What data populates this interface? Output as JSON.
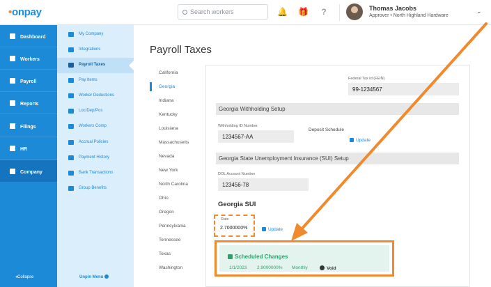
{
  "app": {
    "logo": "onpay"
  },
  "header": {
    "search_placeholder": "Search workers",
    "user_name": "Thomas Jacobs",
    "user_role": "Approver • North Highland Hardware"
  },
  "sidebar": {
    "items": [
      {
        "label": "Dashboard",
        "icon": "dashboard-icon"
      },
      {
        "label": "Workers",
        "icon": "workers-icon"
      },
      {
        "label": "Payroll",
        "icon": "payroll-icon"
      },
      {
        "label": "Reports",
        "icon": "reports-icon"
      },
      {
        "label": "Filings",
        "icon": "filings-icon"
      },
      {
        "label": "HR",
        "icon": "hr-icon"
      },
      {
        "label": "Company",
        "icon": "company-icon",
        "active": true
      }
    ],
    "collapse_label": "Collapse"
  },
  "subnav": {
    "items": [
      {
        "label": "My Company"
      },
      {
        "label": "Integrations"
      },
      {
        "label": "Payroll Taxes",
        "active": true
      },
      {
        "label": "Pay Items"
      },
      {
        "label": "Worker Deductions"
      },
      {
        "label": "Loc/Dep/Pos"
      },
      {
        "label": "Workers Comp"
      },
      {
        "label": "Accrual Policies"
      },
      {
        "label": "Payment History"
      },
      {
        "label": "Bank Transactions"
      },
      {
        "label": "Group Benefits"
      }
    ],
    "unpin_label": "Unpin Menu"
  },
  "main": {
    "title": "Payroll Taxes",
    "states": [
      "California",
      "Georgia",
      "Indiana",
      "Kentucky",
      "Louisiana",
      "Massachusetts",
      "Nevada",
      "New York",
      "North Carolina",
      "Ohio",
      "Oregon",
      "Pennsylvania",
      "Tennessee",
      "Texas",
      "Washington"
    ],
    "active_state": "Georgia"
  },
  "form": {
    "fein_label": "Federal Tax Id (FEIN)",
    "fein_value": "99-1234567",
    "withholding_section": "Georgia Withholding Setup",
    "withholding_id_label": "Withholding ID Number",
    "withholding_id_value": "1234567-AA",
    "deposit_schedule_label": "Deposit Schedule",
    "update_label": "Update",
    "sui_section": "Georgia State Unemployment Insurance (SUI) Setup",
    "dol_label": "DOL Account Number",
    "dol_value": "123456-78",
    "sui_title": "Georgia SUI",
    "rate_label": "Rate",
    "rate_value": "2.7000000%"
  },
  "scheduled": {
    "title": "Scheduled Changes",
    "date": "1/1/2023",
    "rate": "2.9000000%",
    "frequency": "Monthly",
    "void_label": "Void"
  },
  "colors": {
    "brand": "#1d8ad8",
    "annotation": "#f08a2d",
    "success": "#2aa36b"
  }
}
